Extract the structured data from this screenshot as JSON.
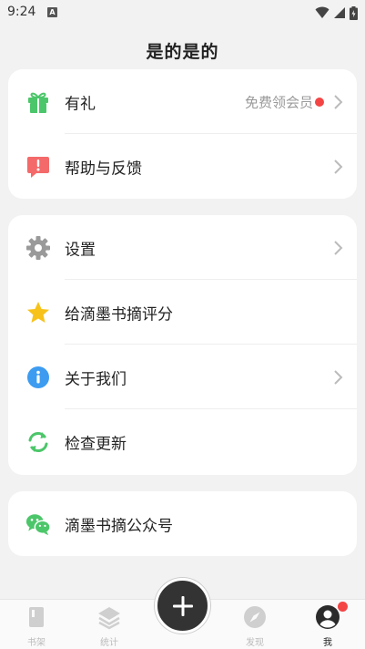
{
  "status": {
    "time": "9:24",
    "notif_letter": "A"
  },
  "header": {
    "title": "是的是的"
  },
  "card1": {
    "gift": {
      "label": "有礼",
      "extra": "免费领会员"
    },
    "help": {
      "label": "帮助与反馈"
    }
  },
  "card2": {
    "settings": {
      "label": "设置"
    },
    "rate": {
      "label": "给滴墨书摘评分"
    },
    "about": {
      "label": "关于我们"
    },
    "update": {
      "label": "检查更新"
    }
  },
  "card3": {
    "wechat": {
      "label": "滴墨书摘公众号"
    }
  },
  "tabs": {
    "bookshelf": "书架",
    "stats": "统计",
    "discover": "发现",
    "me": "我"
  },
  "colors": {
    "gift": "#4cc66a",
    "help": "#f46a6a",
    "settings": "#9a9a9a",
    "star": "#f7c21a",
    "info": "#3d9cf0",
    "refresh": "#4cc66a",
    "wechat": "#4cc66a",
    "badge": "#f44545"
  }
}
